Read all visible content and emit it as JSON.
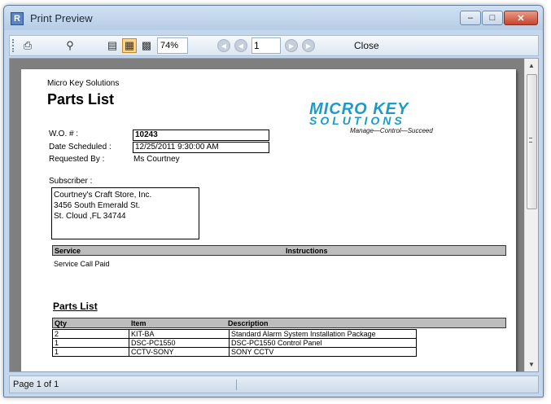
{
  "window": {
    "title": "Print Preview",
    "app_icon_letter": "R"
  },
  "toolbar": {
    "zoom": "74%",
    "page_number": "1",
    "close_label": "Close"
  },
  "status": {
    "page_text": "Page 1 of 1"
  },
  "report": {
    "company": "Micro Key Solutions",
    "title": "Parts List",
    "logo": {
      "line1": "MICRO KEY",
      "line2": "SOLUTIONS",
      "tagline": "Manage—Control—Succeed"
    },
    "wo_label": "W.O. # :",
    "wo_value": "10243",
    "date_label": "Date Scheduled :",
    "date_value": "12/25/2011 9:30:00 AM",
    "requested_label": "Requested By :",
    "requested_value": "Ms Courtney",
    "subscriber_label": "Subscriber :",
    "subscriber_lines": [
      "Courtney's Craft Store, Inc.",
      "3456 South Emerald St.",
      "St. Cloud ,FL 34744"
    ],
    "service_header": "Service",
    "instructions_header": "Instructions",
    "service_value": "Service Call Paid",
    "parts_heading": "Parts List",
    "parts_columns": [
      "Qty",
      "Item",
      "Description"
    ],
    "parts_rows": [
      {
        "qty": "2",
        "item": "KIT-BA",
        "description": "Standard Alarm System Installation Package"
      },
      {
        "qty": "1",
        "item": "DSC-PC1550",
        "description": "DSC-PC1550 Control Panel"
      },
      {
        "qty": "1",
        "item": "CCTV-SONY",
        "description": "SONY CCTV"
      }
    ]
  }
}
